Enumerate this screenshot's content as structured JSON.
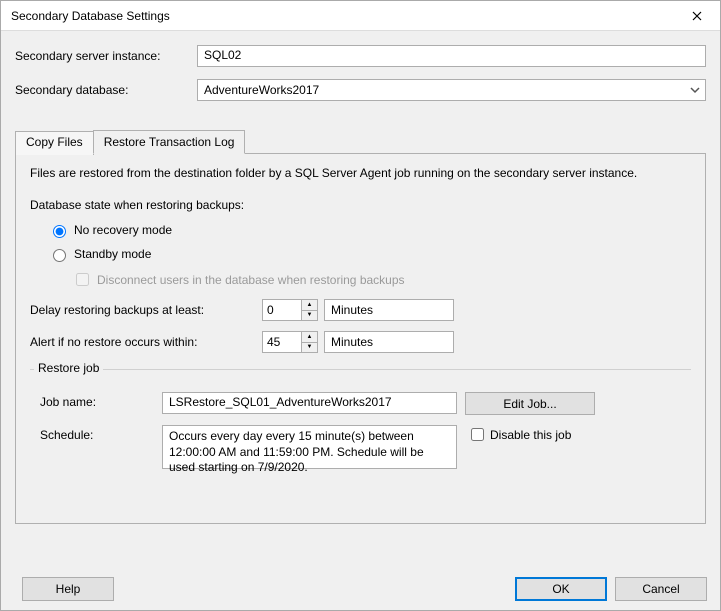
{
  "window": {
    "title": "Secondary Database Settings"
  },
  "fields": {
    "server_instance_label": "Secondary server instance:",
    "server_instance_value": "SQL02",
    "secondary_db_label": "Secondary database:",
    "secondary_db_value": "AdventureWorks2017"
  },
  "tabs": {
    "copy": "Copy Files",
    "restore": "Restore Transaction Log"
  },
  "panel": {
    "intro": "Files are restored from the destination folder by a SQL Server Agent job running on the secondary server instance.",
    "state_label": "Database state when restoring backups:",
    "no_recovery": "No recovery mode",
    "standby": "Standby mode",
    "disconnect_users": "Disconnect users in the database when restoring backups",
    "delay_label": "Delay restoring backups at least:",
    "delay_value": "0",
    "delay_unit": "Minutes",
    "alert_label": "Alert if no restore occurs within:",
    "alert_value": "45",
    "alert_unit": "Minutes"
  },
  "restore_job": {
    "legend": "Restore job",
    "name_label": "Job name:",
    "name_value": "LSRestore_SQL01_AdventureWorks2017",
    "edit_button": "Edit Job...",
    "schedule_label": "Schedule:",
    "schedule_text": "Occurs every day every 15 minute(s) between 12:00:00 AM and 11:59:00 PM. Schedule will be used starting on 7/9/2020.",
    "disable_label": "Disable this job"
  },
  "footer": {
    "help": "Help",
    "ok": "OK",
    "cancel": "Cancel"
  }
}
